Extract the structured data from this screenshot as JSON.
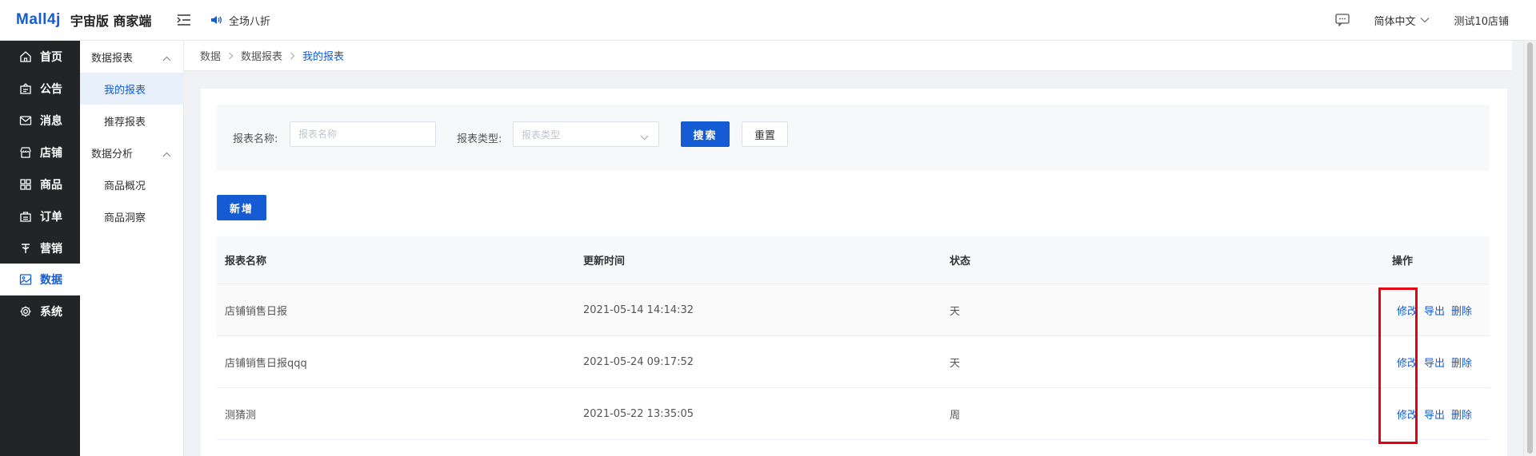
{
  "header": {
    "logo_mark": "Mall4j",
    "logo_title": "宇宙版 商家端",
    "notice": "全场八折",
    "language": "简体中文",
    "shop": "测试10店铺"
  },
  "sidebar": {
    "items": [
      {
        "label": "首页",
        "icon": "home-icon"
      },
      {
        "label": "公告",
        "icon": "notice-icon"
      },
      {
        "label": "消息",
        "icon": "mail-icon"
      },
      {
        "label": "店铺",
        "icon": "shop-icon"
      },
      {
        "label": "商品",
        "icon": "goods-icon"
      },
      {
        "label": "订单",
        "icon": "order-icon"
      },
      {
        "label": "营销",
        "icon": "marketing-icon"
      },
      {
        "label": "数据",
        "icon": "data-icon"
      },
      {
        "label": "系统",
        "icon": "gear-icon"
      }
    ]
  },
  "subnav": {
    "group1": "数据报表",
    "group1_items": [
      "我的报表",
      "推荐报表"
    ],
    "group2": "数据分析",
    "group2_items": [
      "商品概况",
      "商品洞察"
    ]
  },
  "breadcrumb": [
    "数据",
    "数据报表",
    "我的报表"
  ],
  "search": {
    "name_label": "报表名称:",
    "name_placeholder": "报表名称",
    "type_label": "报表类型:",
    "type_placeholder": "报表类型",
    "search_button": "搜索",
    "reset_button": "重置"
  },
  "add_button": "新增",
  "table": {
    "columns": [
      "报表名称",
      "更新时间",
      "状态",
      "操作"
    ],
    "rows": [
      {
        "name": "店铺销售日报",
        "time": "2021-05-14 14:14:32",
        "status": "天"
      },
      {
        "name": "店铺销售日报qqq",
        "time": "2021-05-24 09:17:52",
        "status": "天"
      },
      {
        "name": "测猜测",
        "time": "2021-05-22 13:35:05",
        "status": "周"
      }
    ],
    "actions": [
      "修改",
      "导出",
      "删除"
    ]
  },
  "colors": {
    "primary": "#155bd4",
    "sidebar_bg": "#232426",
    "highlight": "#e60012"
  }
}
